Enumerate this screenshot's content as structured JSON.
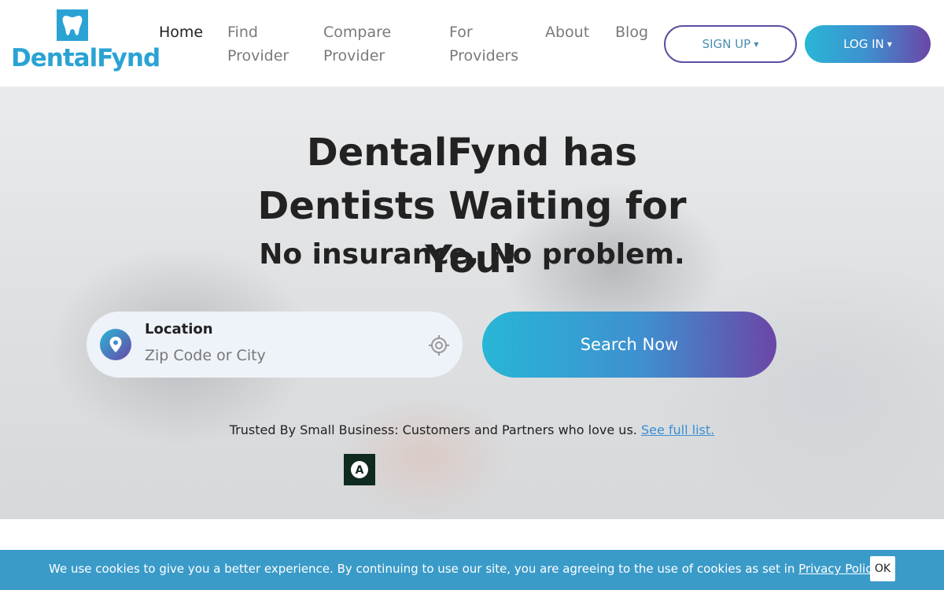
{
  "brand": {
    "name": "DentalFynd",
    "color": "#2aa3d4"
  },
  "nav": {
    "home": "Home",
    "find_provider": "Find Provider",
    "compare_provider": "Compare Provider",
    "for_providers": "For Providers",
    "about": "About",
    "blog": "Blog"
  },
  "auth": {
    "signup_label": "SIGN UP",
    "login_label": "LOG IN"
  },
  "hero": {
    "title": "DentalFynd has Dentists Waiting for You!",
    "subtitle": "No insurance, No problem."
  },
  "search": {
    "location_label": "Location",
    "placeholder": "Zip Code or City",
    "button_label": "Search Now"
  },
  "trusted": {
    "text": "Trusted By Small Business: Customers and Partners who love us.",
    "link_label": "See full list."
  },
  "partner": {
    "logo_letter": "A"
  },
  "cookie": {
    "text": "We use cookies to give you a better experience. By continuing to use our site, you are agreeing to the use of cookies as set in",
    "link_label": "Privacy Policy",
    "ok_label": "OK"
  },
  "colors": {
    "accent_start": "#28b6d6",
    "accent_end": "#6b46a6",
    "cookie_bar": "#3a9bc9"
  }
}
